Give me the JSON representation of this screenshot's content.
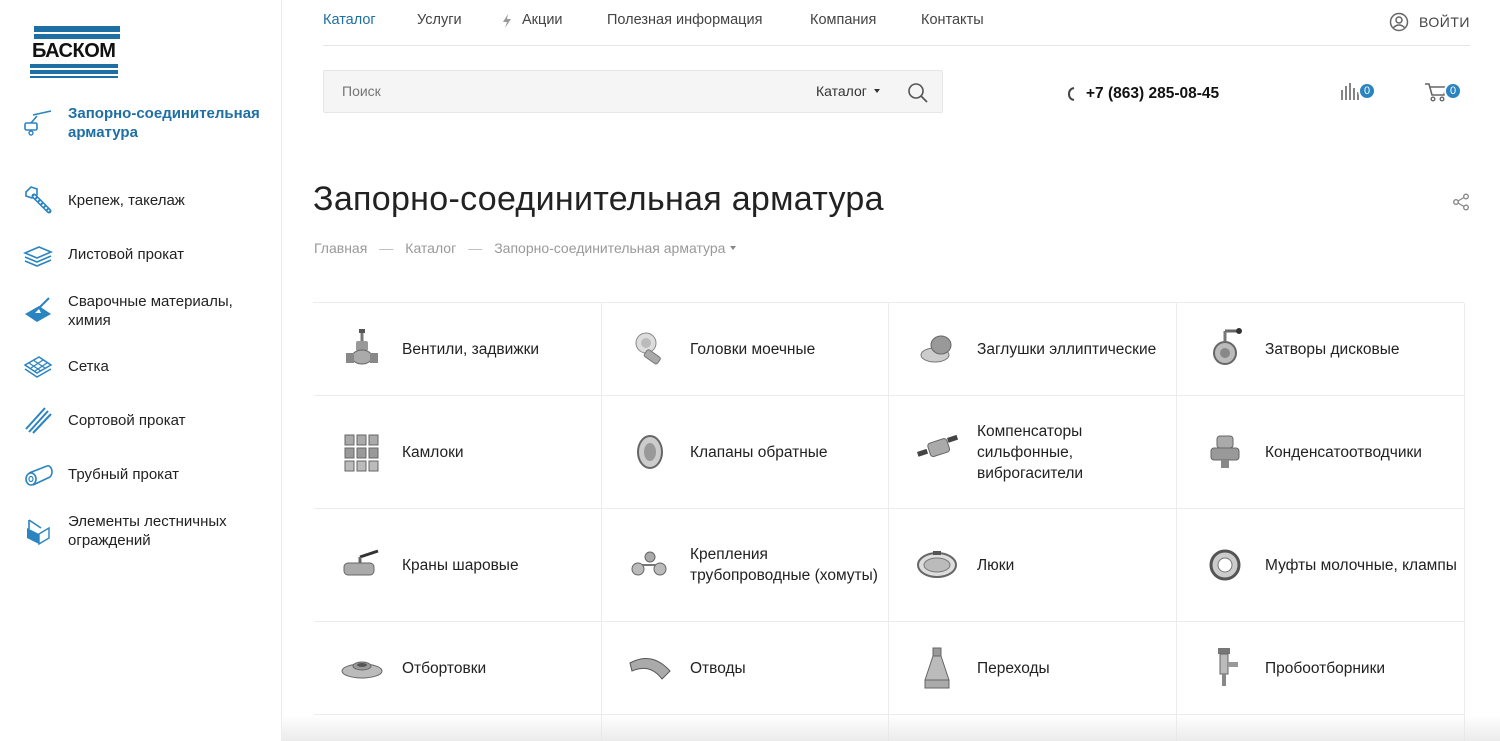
{
  "logo": {
    "text": "БАСКОМ"
  },
  "sidebar": {
    "items": [
      {
        "label": "Запорно-соединительная арматура",
        "icon": "valve-icon",
        "active": true
      },
      {
        "label": "Крепеж, такелаж",
        "icon": "bolt-icon"
      },
      {
        "label": "Листовой прокат",
        "icon": "sheet-metal-icon"
      },
      {
        "label": "Сварочные материалы, химия",
        "icon": "welding-icon"
      },
      {
        "label": "Сетка",
        "icon": "mesh-icon"
      },
      {
        "label": "Сортовой прокат",
        "icon": "bar-stock-icon"
      },
      {
        "label": "Трубный прокат",
        "icon": "pipe-icon"
      },
      {
        "label": "Элементы лестничных ограждений",
        "icon": "railing-icon"
      }
    ]
  },
  "nav": {
    "items": [
      "Каталог",
      "Услуги",
      "Акции",
      "Полезная информация",
      "Компания",
      "Контакты"
    ],
    "login": "ВОЙТИ"
  },
  "search": {
    "placeholder": "Поиск",
    "scope": "Каталог"
  },
  "phone": "+7 (863) 285-08-45",
  "compare_count": "0",
  "cart_count": "0",
  "page": {
    "title": "Запорно-соединительная арматура"
  },
  "breadcrumb": [
    "Главная",
    "Каталог",
    "Запорно-соединительная арматура"
  ],
  "catalog": [
    {
      "label": "Вентили, задвижки",
      "icon": "gate-valve-icon"
    },
    {
      "label": "Головки моечные",
      "icon": "wash-head-icon"
    },
    {
      "label": "Заглушки эллиптические",
      "icon": "end-cap-icon"
    },
    {
      "label": "Затворы дисковые",
      "icon": "butterfly-valve-icon"
    },
    {
      "label": "Камлоки",
      "icon": "camlock-icon"
    },
    {
      "label": "Клапаны обратные",
      "icon": "check-valve-icon"
    },
    {
      "label": "Компенсаторы сильфонные, виброгасители",
      "icon": "bellows-icon"
    },
    {
      "label": "Конденсатоотводчики",
      "icon": "steam-trap-icon"
    },
    {
      "label": "Краны шаровые",
      "icon": "ball-valve-icon"
    },
    {
      "label": "Крепления трубопроводные (хомуты)",
      "icon": "pipe-clamp-icon"
    },
    {
      "label": "Люки",
      "icon": "hatch-icon"
    },
    {
      "label": "Муфты молочные, клампы",
      "icon": "dairy-coupling-icon"
    },
    {
      "label": "Отбортовки",
      "icon": "flange-collar-icon"
    },
    {
      "label": "Отводы",
      "icon": "elbow-icon"
    },
    {
      "label": "Переходы",
      "icon": "reducer-icon"
    },
    {
      "label": "Пробоотборники",
      "icon": "sampler-icon"
    }
  ],
  "colors": {
    "accent": "#1e6fa3",
    "badge": "#2a84c0",
    "border": "#ececec"
  }
}
